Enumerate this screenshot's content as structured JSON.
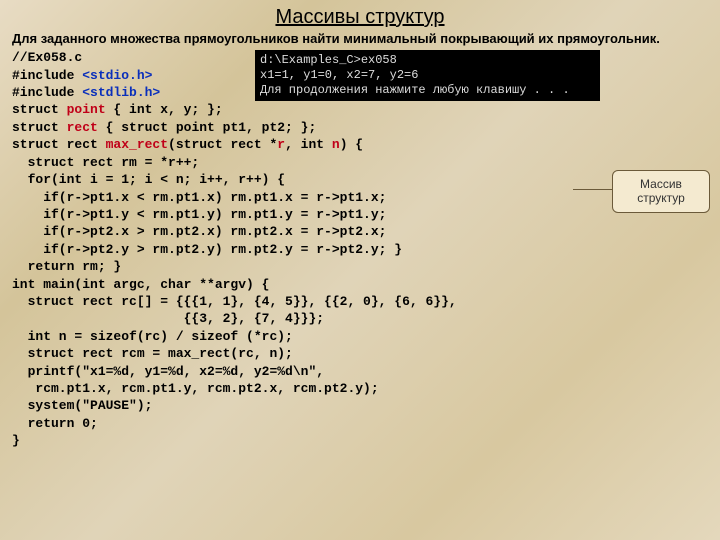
{
  "title": "Массивы структур",
  "description": "Для заданного множества прямоугольников найти минимальный покрывающий их прямоугольник.",
  "console": {
    "line1": "d:\\Examples_C>ex058",
    "line2": "x1=1, y1=0, x2=7, y2=6",
    "line3": "Для продолжения нажмите любую клавишу . . ."
  },
  "callout": "Массив структур",
  "code": {
    "l01": "//Ex058.c",
    "l02a": "#include ",
    "l02b": "<stdio.h>",
    "l03a": "#include ",
    "l03b": "<stdlib.h>",
    "l04a": "struct ",
    "l04b": "point",
    "l04c": " { int x, y; };",
    "l05a": "struct ",
    "l05b": "rect",
    "l05c": " { struct point pt1, pt2; };",
    "l06a": "struct rect ",
    "l06b": "max_rect",
    "l06c": "(struct rect *",
    "l06d": "r",
    "l06e": ", int ",
    "l06f": "n",
    "l06g": ") {",
    "l07": "  struct rect rm = *r++;",
    "l08": "  for(int i = 1; i < n; i++, r++) {",
    "l09": "    if(r->pt1.x < rm.pt1.x) rm.pt1.x = r->pt1.x;",
    "l10": "    if(r->pt1.y < rm.pt1.y) rm.pt1.y = r->pt1.y;",
    "l11": "    if(r->pt2.x > rm.pt2.x) rm.pt2.x = r->pt2.x;",
    "l12": "    if(r->pt2.y > rm.pt2.y) rm.pt2.y = r->pt2.y; }",
    "l13": "  return rm; }",
    "l14": "int main(int argc, char **argv) {",
    "l15": "  struct rect rc[] = {{{1, 1}, {4, 5}}, {{2, 0}, {6, 6}},",
    "l16": "                      {{3, 2}, {7, 4}}};",
    "l17": "  int n = sizeof(rc) / sizeof (*rc);",
    "l18": "  struct rect rcm = max_rect(rc, n);",
    "l19": "  printf(\"x1=%d, y1=%d, x2=%d, y2=%d\\n\",",
    "l20": "   rcm.pt1.x, rcm.pt1.y, rcm.pt2.x, rcm.pt2.y);",
    "l21": "  system(\"PAUSE\");",
    "l22": "  return 0;",
    "l23": "}"
  }
}
